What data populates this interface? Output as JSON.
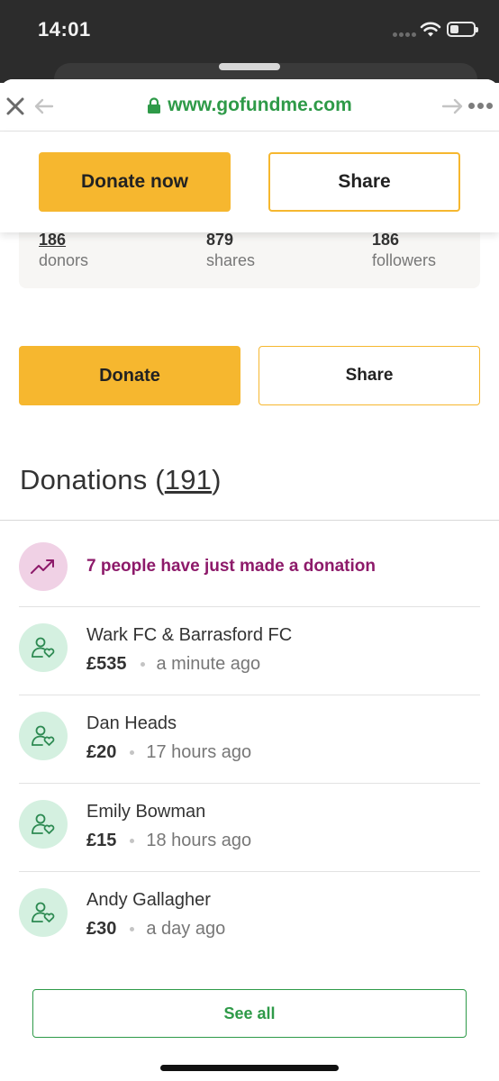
{
  "status_bar": {
    "time": "14:01"
  },
  "browser": {
    "url": "www.gofundme.com"
  },
  "sticky_bar": {
    "donate_label": "Donate now",
    "share_label": "Share"
  },
  "stats": {
    "donors": {
      "value": "186",
      "label": "donors"
    },
    "shares": {
      "value": "879",
      "label": "shares"
    },
    "followers": {
      "value": "186",
      "label": "followers"
    }
  },
  "actions": {
    "donate_label": "Donate",
    "share_label": "Share"
  },
  "donations": {
    "heading": "Donations",
    "count": "191",
    "trend_text": "7 people have just made a donation",
    "items": [
      {
        "name": "Wark FC & Barrasford FC",
        "amount": "£535",
        "time": "a minute ago"
      },
      {
        "name": "Dan Heads",
        "amount": "£20",
        "time": "17 hours ago"
      },
      {
        "name": "Emily Bowman",
        "amount": "£15",
        "time": "18 hours ago"
      },
      {
        "name": "Andy Gallagher",
        "amount": "£30",
        "time": "a day ago"
      }
    ],
    "see_all_label": "See all"
  },
  "colors": {
    "primary_yellow": "#f6b72f",
    "brand_green": "#2e9a48",
    "trend_purple": "#8d1a6a",
    "trend_bg": "#f0d1e5",
    "avatar_bg": "#d4f0e0"
  },
  "icons": [
    "close-icon",
    "back-arrow-icon",
    "lock-icon",
    "forward-arrow-icon",
    "more-dots-icon",
    "wifi-icon",
    "battery-icon",
    "trending-up-icon",
    "donor-heart-icon"
  ]
}
